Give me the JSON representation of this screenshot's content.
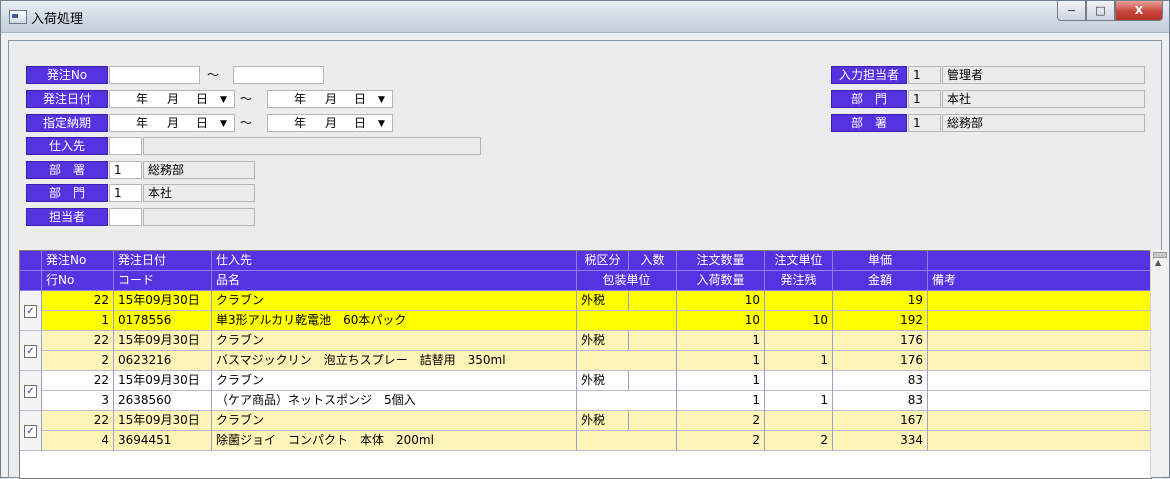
{
  "window": {
    "title": "入荷処理",
    "min": "−",
    "max": "□",
    "close": "X"
  },
  "search": {
    "order_no_label": "発注No",
    "order_no_from": "",
    "order_no_to": "",
    "tilde": "〜",
    "order_date_label": "発注日付",
    "due_date_label": "指定納期",
    "date_placeholder": {
      "y": "年",
      "m": "月",
      "d": "日",
      "arrow": "▼"
    },
    "supplier_label": "仕入先",
    "supplier_code": "",
    "supplier_name": "",
    "bu_sho_label": "部　署",
    "bu_sho_code": "1",
    "bu_sho_name": "総務部",
    "bu_mon_label": "部　門",
    "bu_mon_code": "1",
    "bu_mon_name": "本社",
    "staff_label": "担当者",
    "staff_code": "",
    "staff_name": ""
  },
  "operator": {
    "input_staff_label": "入力担当者",
    "input_staff_code": "1",
    "input_staff_name": "管理者",
    "bu_mon_label": "部　門",
    "bu_mon_code": "1",
    "bu_mon_name": "本社",
    "bu_sho_label": "部　署",
    "bu_sho_code": "1",
    "bu_sho_name": "総務部"
  },
  "grid": {
    "headers_top": [
      "",
      "発注No",
      "発注日付",
      "仕入先",
      "税区分",
      "入数",
      "注文数量",
      "注文単位",
      "単価",
      ""
    ],
    "headers_bottom": [
      "",
      "行No",
      "コード",
      "品名",
      "包装単位",
      "入荷数量",
      "発注残",
      "金額",
      "備考"
    ],
    "check_mark": "✓",
    "rows": [
      {
        "checked": true,
        "order_no": "22",
        "date": "15年09月30日",
        "supplier": "クラブン",
        "tax": "外税",
        "qty_per": "",
        "order_qty": "10",
        "order_unit": "",
        "price": "19",
        "line_no": "1",
        "code": "0178556",
        "item": "単3形アルカリ乾電池　60本パック",
        "pack_unit": "",
        "recv_qty": "10",
        "remain": "10",
        "amount": "192",
        "note": ""
      },
      {
        "checked": true,
        "order_no": "22",
        "date": "15年09月30日",
        "supplier": "クラブン",
        "tax": "外税",
        "qty_per": "",
        "order_qty": "1",
        "order_unit": "",
        "price": "176",
        "line_no": "2",
        "code": "0623216",
        "item": "バスマジックリン　泡立ちスプレー　詰替用　350ml",
        "pack_unit": "",
        "recv_qty": "1",
        "remain": "1",
        "amount": "176",
        "note": ""
      },
      {
        "checked": true,
        "order_no": "22",
        "date": "15年09月30日",
        "supplier": "クラブン",
        "tax": "外税",
        "qty_per": "",
        "order_qty": "1",
        "order_unit": "",
        "price": "83",
        "line_no": "3",
        "code": "2638560",
        "item": "（ケア商品）ネットスポンジ　5個入",
        "pack_unit": "",
        "recv_qty": "1",
        "remain": "1",
        "amount": "83",
        "note": ""
      },
      {
        "checked": true,
        "order_no": "22",
        "date": "15年09月30日",
        "supplier": "クラブン",
        "tax": "外税",
        "qty_per": "",
        "order_qty": "2",
        "order_unit": "",
        "price": "167",
        "line_no": "4",
        "code": "3694451",
        "item": "除菌ジョイ　コンパクト　本体　200ml",
        "pack_unit": "",
        "recv_qty": "2",
        "remain": "2",
        "amount": "334",
        "note": ""
      }
    ]
  },
  "colors": {
    "label_bg": "#5533e0",
    "row_selected": "#ffff00",
    "row_alt": "#fff4b8",
    "row_normal": "#ffffff"
  }
}
